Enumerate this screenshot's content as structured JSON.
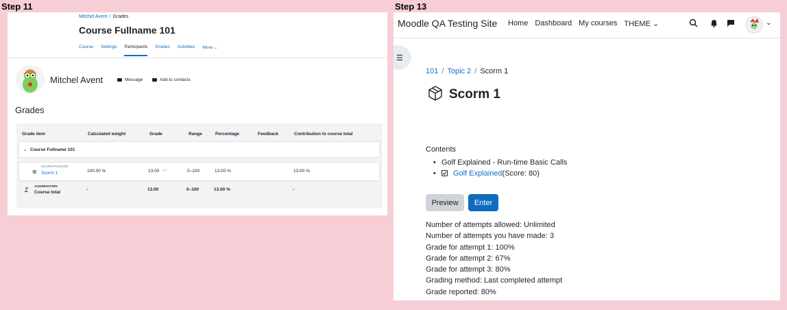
{
  "labels": {
    "step11": "Step 11",
    "step13": "Step 13"
  },
  "step11": {
    "breadcrumb": [
      "Mitchel Avent",
      "Grades"
    ],
    "course_title": "Course Fullname 101",
    "secondary_nav": [
      {
        "label": "Course"
      },
      {
        "label": "Settings"
      },
      {
        "label": "Participants",
        "active": true
      },
      {
        "label": "Grades"
      },
      {
        "label": "Activities"
      },
      {
        "label": "More ⌄"
      }
    ],
    "user_name": "Mitchel Avent",
    "message_label": "Message",
    "add_contacts_label": "Add to contacts",
    "grades_heading": "Grades",
    "table": {
      "headers": [
        "Grade item",
        "Calculated weight",
        "Grade",
        "Range",
        "Percentage",
        "Feedback",
        "Contribution to course total"
      ],
      "category": "Course Fullname 101",
      "item": {
        "type": "SCORM PACKAGE",
        "name": "Scorm 1",
        "weight": "100.00 %",
        "grade": "13.00",
        "menu": "···",
        "range": "0–100",
        "percentage": "13.00 %",
        "contribution": "13.00 %"
      },
      "total": {
        "type": "AGGREGATION",
        "name": "Course total",
        "weight": "-",
        "grade": "13.00",
        "range": "0–100",
        "percentage": "13.00 %",
        "contribution": "-"
      }
    }
  },
  "step13": {
    "site_name": "Moodle QA Testing Site",
    "nav": [
      "Home",
      "Dashboard",
      "My courses",
      "THEME ⌄"
    ],
    "breadcrumb": [
      "101",
      "Topic 2",
      "Scorm 1"
    ],
    "title": "Scorm 1",
    "contents_label": "Contents",
    "toc": [
      {
        "text": "Golf Explained - Run-time Basic Calls"
      },
      {
        "link": "Golf Explained",
        "suffix": "(Score: 80)"
      }
    ],
    "preview_label": "Preview",
    "enter_label": "Enter",
    "info": [
      "Number of attempts allowed: Unlimited",
      "Number of attempts you have made: 3",
      "Grade for attempt 1: 100%",
      "Grade for attempt 2: 67%",
      "Grade for attempt 3: 80%",
      "Grading method: Last completed attempt",
      "Grade reported: 80%"
    ]
  },
  "colors": {
    "link": "#0f6cbf",
    "background": "#f7ced5",
    "table_bg": "#f1f3f5"
  }
}
